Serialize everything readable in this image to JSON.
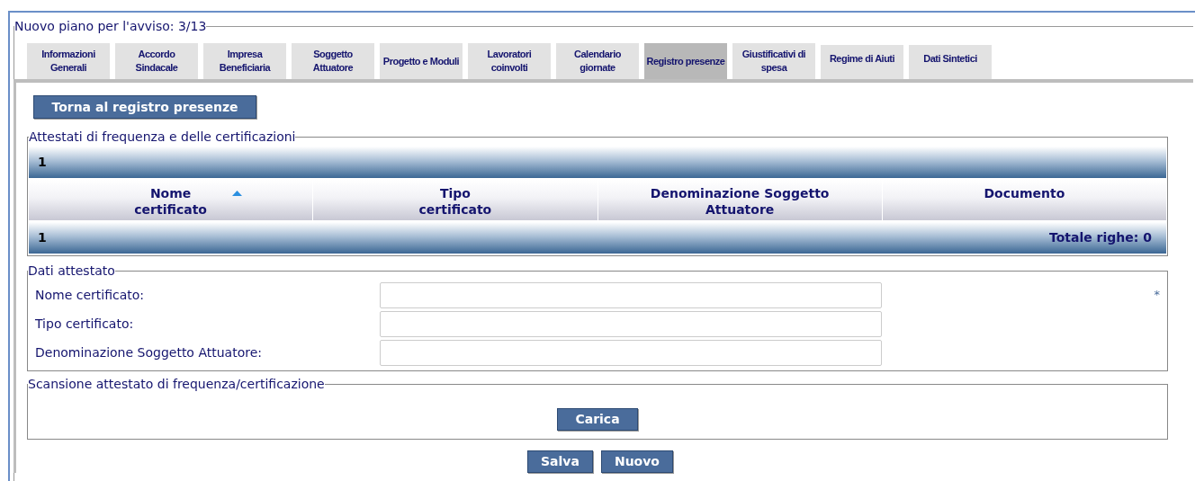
{
  "form": {
    "title": "Nuovo piano per l'avviso: 3/13"
  },
  "tabs": [
    {
      "label": "Informazioni Generali",
      "selected": false
    },
    {
      "label": "Accordo Sindacale",
      "selected": false
    },
    {
      "label": "Impresa Beneficiaria",
      "selected": false
    },
    {
      "label": "Soggetto Attuatore",
      "selected": false
    },
    {
      "label": "Progetto e Moduli",
      "selected": false
    },
    {
      "label": "Lavoratori coinvolti",
      "selected": false
    },
    {
      "label": "Calendario giornate",
      "selected": false
    },
    {
      "label": "Registro presenze",
      "selected": true
    },
    {
      "label": "Giustificativi di spesa",
      "selected": false
    },
    {
      "label": "Regime di Aiuti",
      "selected": false
    },
    {
      "label": "Dati Sintetici",
      "selected": false
    }
  ],
  "back_button": "Torna al registro presenze",
  "certificates": {
    "title": "Attestati di frequenza e delle certificazioni",
    "top_pager": "1",
    "bottom_pager": "1",
    "total": "Totale righe: 0",
    "columns": [
      {
        "label": "Nome certificato",
        "sorted": true
      },
      {
        "label": "Tipo certificato",
        "sorted": false
      },
      {
        "label": "Denominazione Soggetto Attuatore",
        "sorted": false
      },
      {
        "label": "Documento",
        "sorted": false
      }
    ]
  },
  "details": {
    "title": "Dati attestato",
    "fields": [
      {
        "label": "Nome certificato:",
        "required_mark": "*"
      },
      {
        "label": "Tipo certificato:"
      },
      {
        "label": "Denominazione Soggetto Attuatore:"
      }
    ]
  },
  "scan": {
    "title": "Scansione attestato di frequenza/certificazione",
    "button": "Carica"
  },
  "buttons": [
    "Salva",
    "Nuovo"
  ]
}
